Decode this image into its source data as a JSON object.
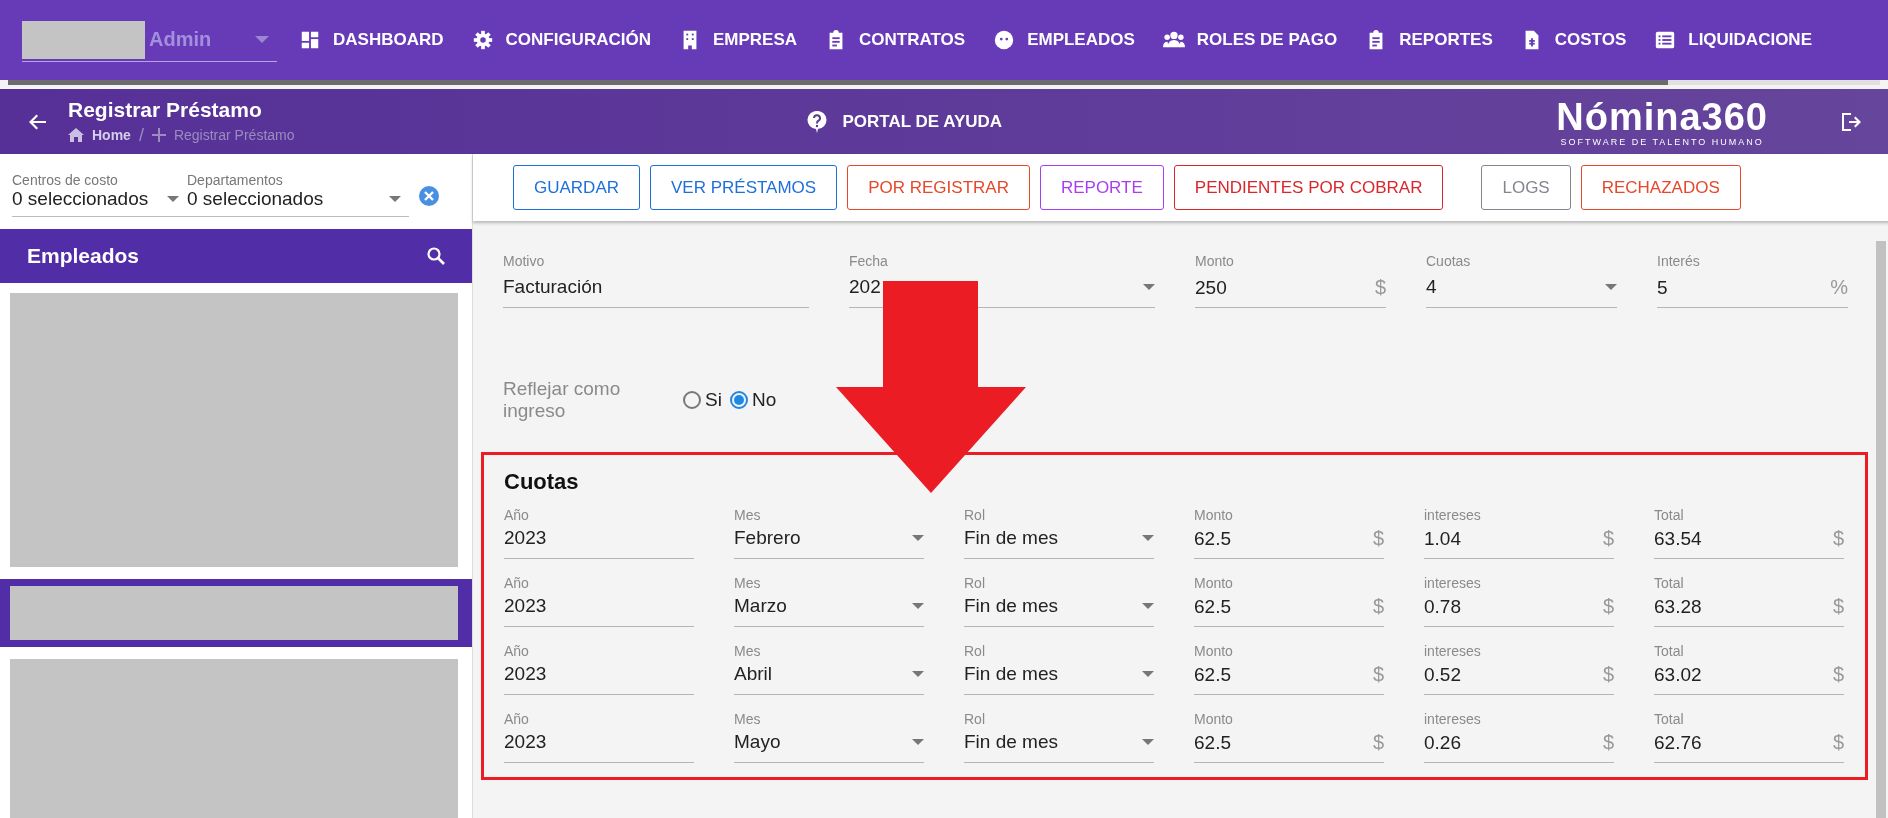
{
  "nav": {
    "user": "Admin",
    "items": [
      {
        "label": "DASHBOARD"
      },
      {
        "label": "CONFIGURACIÓN"
      },
      {
        "label": "EMPRESA"
      },
      {
        "label": "CONTRATOS"
      },
      {
        "label": "EMPLEADOS"
      },
      {
        "label": "ROLES DE PAGO"
      },
      {
        "label": "REPORTES"
      },
      {
        "label": "COSTOS"
      },
      {
        "label": "LIQUIDACIONE"
      }
    ]
  },
  "header": {
    "title": "Registrar Préstamo",
    "breadcrumb": [
      "Home",
      "Registrar Préstamo"
    ],
    "breadcrumb_separator": "/",
    "help": "PORTAL DE AYUDA",
    "logo": "Nómina360",
    "tagline": "SOFTWARE DE TALENTO HUMANO"
  },
  "filters": [
    {
      "label": "Centros de costo",
      "value": "0 seleccionados"
    },
    {
      "label": "Departamentos",
      "value": "0 seleccionados"
    }
  ],
  "employees": {
    "title": "Empleados",
    "items": [
      {
        "selected": false
      },
      {
        "selected": true
      },
      {
        "selected": false
      }
    ]
  },
  "buttons": [
    {
      "label": "GUARDAR",
      "color": "#1e6fd9"
    },
    {
      "label": "VER PRÉSTAMOS",
      "color": "#1e6fd9"
    },
    {
      "label": "POR REGISTRAR",
      "color": "#e5482a"
    },
    {
      "label": "REPORTE",
      "color": "#a83ef0"
    },
    {
      "label": "PENDIENTES POR COBRAR",
      "color": "#d9262b"
    },
    {
      "label": "LOGS",
      "color": "#858590"
    },
    {
      "label": "RECHAZADOS",
      "color": "#e5482a"
    }
  ],
  "form": [
    {
      "label": "Motivo",
      "value": "Facturación",
      "kind": "text"
    },
    {
      "label": "Fecha",
      "value": "202",
      "kind": "select"
    },
    {
      "label": "Monto",
      "value": "250",
      "kind": "suffix",
      "suffix": "$"
    },
    {
      "label": "Cuotas",
      "value": "4",
      "kind": "select"
    },
    {
      "label": "Interés",
      "value": "5",
      "kind": "suffix",
      "suffix": "%"
    }
  ],
  "reflect": {
    "label": "Reflejar como ingreso",
    "options": [
      {
        "label": "Si",
        "selected": false
      },
      {
        "label": "No",
        "selected": true
      }
    ]
  },
  "cuotas": {
    "title": "Cuotas",
    "rows": [
      [
        {
          "label": "Año",
          "value": "2023",
          "kind": "text"
        },
        {
          "label": "Mes",
          "value": "Febrero",
          "kind": "select"
        },
        {
          "label": "Rol",
          "value": "Fin de mes",
          "kind": "select"
        },
        {
          "label": "Monto",
          "value": "62.5",
          "kind": "suffix",
          "suffix": "$"
        },
        {
          "label": "intereses",
          "value": "1.04",
          "kind": "suffix",
          "suffix": "$"
        },
        {
          "label": "Total",
          "value": "63.54",
          "kind": "suffix",
          "suffix": "$"
        }
      ],
      [
        {
          "label": "Año",
          "value": "2023",
          "kind": "text"
        },
        {
          "label": "Mes",
          "value": "Marzo",
          "kind": "select"
        },
        {
          "label": "Rol",
          "value": "Fin de mes",
          "kind": "select"
        },
        {
          "label": "Monto",
          "value": "62.5",
          "kind": "suffix",
          "suffix": "$"
        },
        {
          "label": "intereses",
          "value": "0.78",
          "kind": "suffix",
          "suffix": "$"
        },
        {
          "label": "Total",
          "value": "63.28",
          "kind": "suffix",
          "suffix": "$"
        }
      ],
      [
        {
          "label": "Año",
          "value": "2023",
          "kind": "text"
        },
        {
          "label": "Mes",
          "value": "Abril",
          "kind": "select"
        },
        {
          "label": "Rol",
          "value": "Fin de mes",
          "kind": "select"
        },
        {
          "label": "Monto",
          "value": "62.5",
          "kind": "suffix",
          "suffix": "$"
        },
        {
          "label": "intereses",
          "value": "0.52",
          "kind": "suffix",
          "suffix": "$"
        },
        {
          "label": "Total",
          "value": "63.02",
          "kind": "suffix",
          "suffix": "$"
        }
      ],
      [
        {
          "label": "Año",
          "value": "2023",
          "kind": "text"
        },
        {
          "label": "Mes",
          "value": "Mayo",
          "kind": "select"
        },
        {
          "label": "Rol",
          "value": "Fin de mes",
          "kind": "select"
        },
        {
          "label": "Monto",
          "value": "62.5",
          "kind": "suffix",
          "suffix": "$"
        },
        {
          "label": "intereses",
          "value": "0.26",
          "kind": "suffix",
          "suffix": "$"
        },
        {
          "label": "Total",
          "value": "62.76",
          "kind": "suffix",
          "suffix": "$"
        }
      ]
    ]
  }
}
